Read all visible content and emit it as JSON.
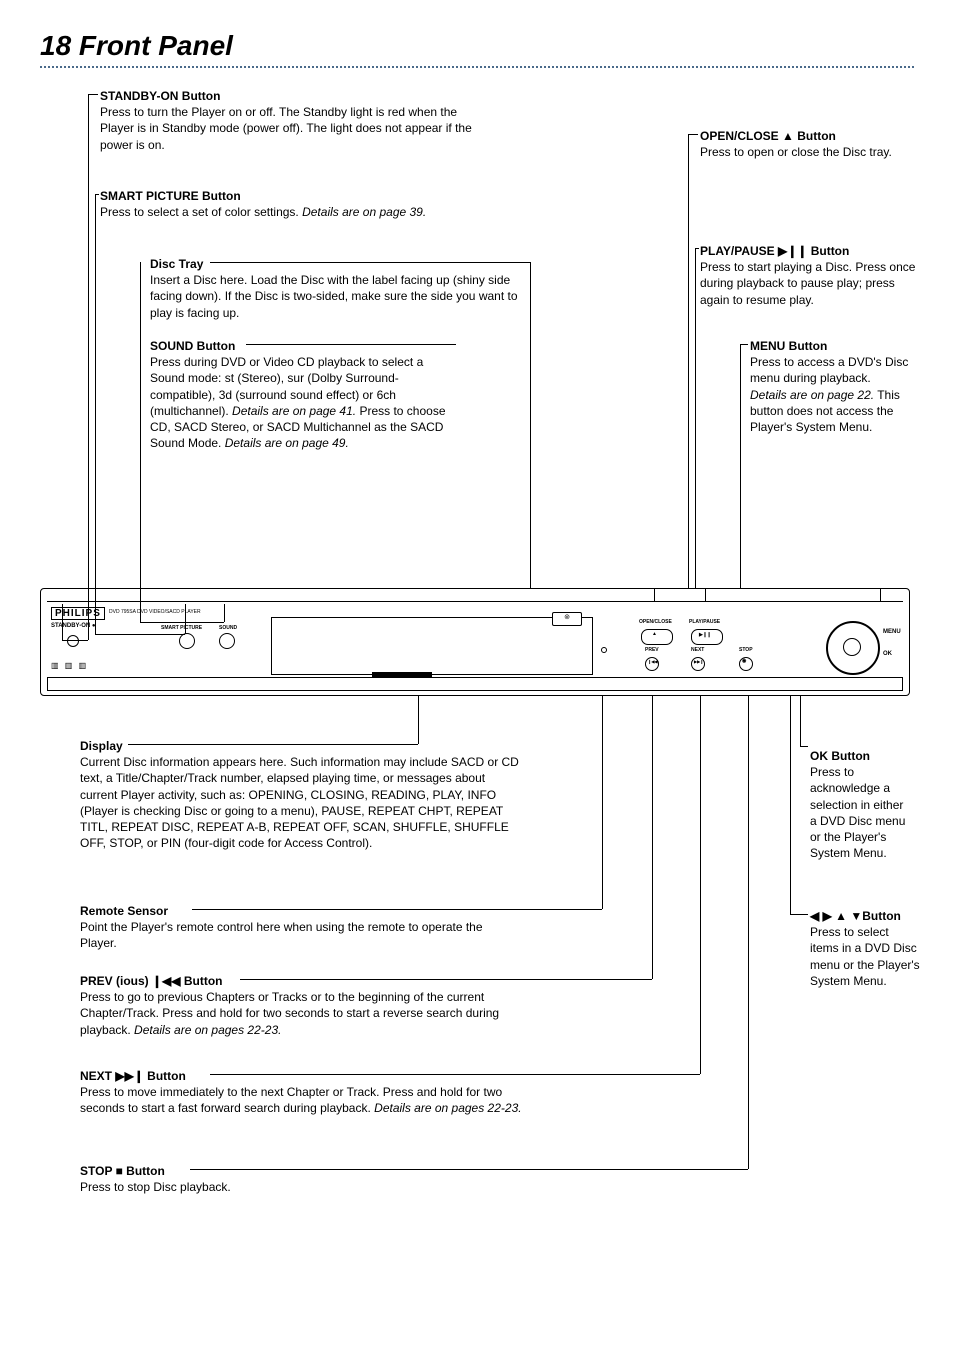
{
  "page": {
    "number_title": "18  Front Panel"
  },
  "standby": {
    "title": "STANDBY-ON Button",
    "body": "Press to turn the Player on or off. The Standby light is red when the Player is in Standby mode (power off). The light does not appear if the power is on."
  },
  "smart_picture": {
    "title": "SMART PICTURE Button",
    "body_a": "Press to select a set of color settings. ",
    "body_b": "Details are on page 39."
  },
  "disc_tray": {
    "title": "Disc Tray",
    "body": "Insert a Disc here. Load the Disc with the label facing up (shiny side facing down). If the Disc is two-sided, make sure the side you want to play is facing up."
  },
  "sound": {
    "title": "SOUND Button",
    "body_a": "Press during DVD or Video CD playback to select a Sound mode: st (Stereo), sur (Dolby Surround-compatible), 3d (surround sound effect) or 6ch (multichannel). ",
    "body_b": "Details are on page 41.",
    "body_c": " Press to choose CD, SACD Stereo, or SACD Multichannel as the SACD Sound Mode. ",
    "body_d": "Details are on page 49."
  },
  "open_close": {
    "title": "OPEN/CLOSE ▲ Button",
    "body": "Press to open or close the Disc tray."
  },
  "play_pause": {
    "title": "PLAY/PAUSE ▶❙❙  Button",
    "body": "Press to start playing a Disc. Press once during playback to pause play; press again to resume play."
  },
  "menu": {
    "title": "MENU Button",
    "body_a": "Press to access a DVD's Disc menu during playback. ",
    "body_b": "Details are on page 22.",
    "body_c": " This button does not access the Player's System Menu."
  },
  "display": {
    "title": "Display",
    "body": "Current Disc information appears here. Such information may include SACD or CD text, a Title/Chapter/Track number, elapsed playing time, or messages about current Player activity, such as: OPENING, CLOSING, READING, PLAY, INFO (Player is checking Disc or going to a menu), PAUSE, REPEAT CHPT, REPEAT TITL, REPEAT DISC, REPEAT A-B, REPEAT OFF, SCAN, SHUFFLE, SHUFFLE OFF, STOP, or PIN (four-digit code for Access Control)."
  },
  "remote": {
    "title": "Remote Sensor",
    "body": "Point the Player's remote control here when using the remote to operate the Player."
  },
  "prev": {
    "title": "PREV (ious) ❙◀◀  Button",
    "body_a": "Press to go to previous Chapters or Tracks or to the beginning of the current Chapter/Track. Press and hold for two seconds to start a reverse search during playback. ",
    "body_b": "Details are on pages 22-23."
  },
  "next": {
    "title": "NEXT ▶▶❙ Button",
    "body_a": "Press to move immediately to the next Chapter or Track. Press and hold for two seconds to start a fast forward search during playback. ",
    "body_b": "Details are on pages 22-23."
  },
  "stop": {
    "title": "STOP ■ Button",
    "body": "Press to stop Disc playback."
  },
  "ok": {
    "title": "OK Button",
    "body": "Press to acknowledge a selection in either a DVD Disc menu or the Player's System Menu."
  },
  "arrows": {
    "title": "◀ ▶ ▲ ▼Button",
    "body": "Press to select items in a DVD Disc menu or the Player's System Menu."
  },
  "panel": {
    "brand": "PHILIPS",
    "model": "DVD 795SA DVD VIDEO/SACD PLAYER",
    "standby_label": "STANDBY-ON ●",
    "smart_pic": "SMART PICTURE",
    "sound": "SOUND",
    "open_close": "OPEN/CLOSE",
    "play_pause": "PLAY/PAUSE",
    "prev": "PREV",
    "next": "NEXT",
    "stop": "STOP",
    "menu": "MENU",
    "ok": "OK",
    "open_sym": "▲",
    "play_sym": "▶❙❙",
    "prev_sym": "❙◀◀",
    "next_sym": "▶▶❙",
    "stop_sym": "◉",
    "disc_badge": "⊚",
    "logos": "▥  ▥  ▥"
  }
}
